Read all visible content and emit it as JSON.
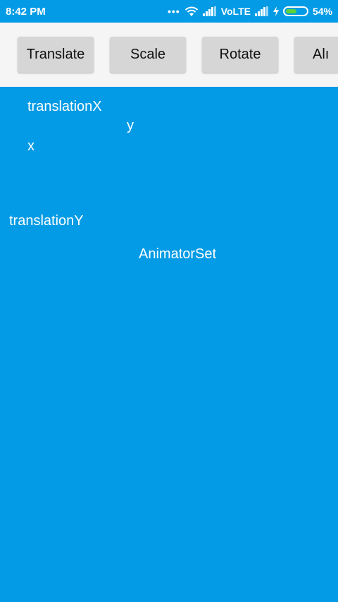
{
  "status_bar": {
    "time": "8:42 PM",
    "network": "VoLTE",
    "battery_percent": "54%",
    "battery_level": 0.54
  },
  "toolbar": {
    "buttons": [
      "Translate",
      "Scale",
      "Rotate",
      "Alpha"
    ],
    "partial_label": "Alı"
  },
  "stage": {
    "labels": [
      "translationX",
      "y",
      "x",
      "translationY",
      "AnimatorSet"
    ]
  },
  "colors": {
    "background": "#039BE5",
    "toolbar": "#F5F5F5",
    "button": "#D6D6D6"
  }
}
